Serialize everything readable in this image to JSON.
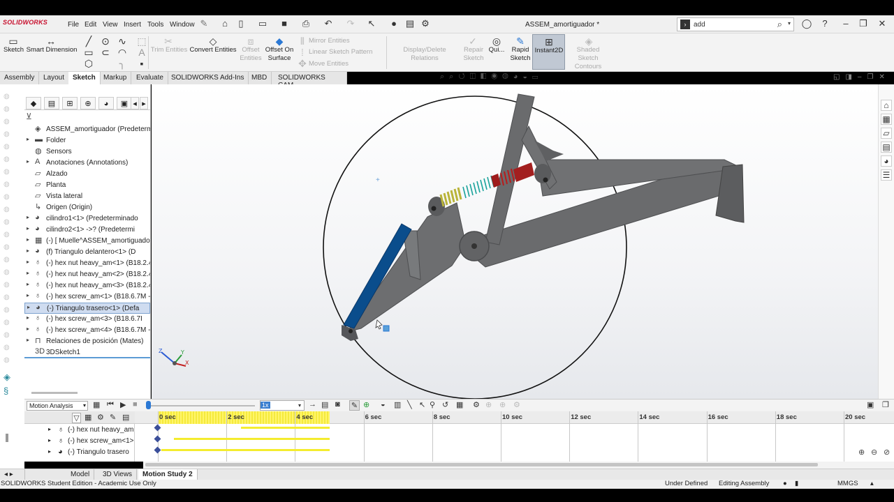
{
  "app": {
    "logo": "SOLIDWORKS",
    "doc_title": "ASSEM_amortiguador *"
  },
  "menu": [
    "File",
    "Edit",
    "View",
    "Insert",
    "Tools",
    "Window"
  ],
  "search": {
    "value": "add",
    "placeholder": ""
  },
  "ribbon": {
    "sketch": "Sketch",
    "smart_dimension": "Smart Dimension",
    "trim_entities": "Trim Entities",
    "convert_entities": "Convert Entities",
    "offset_entities": "Offset\nEntities",
    "offset_on_surface": "Offset On\nSurface",
    "mirror_entities": "Mirror Entities",
    "linear_sketch_pattern": "Linear Sketch Pattern",
    "move_entities": "Move Entities",
    "display_delete_relations": "Display/Delete Relations",
    "repair_sketch": "Repair\nSketch",
    "quick_snaps": "Qui...",
    "rapid_sketch": "Rapid\nSketch",
    "instant2d": "Instant2D",
    "shaded_sketch_contours": "Shaded Sketch\nContours"
  },
  "tabs": [
    "Assembly",
    "Layout",
    "Sketch",
    "Markup",
    "Evaluate",
    "SOLIDWORKS Add-Ins",
    "MBD",
    "SOLIDWORKS CAM"
  ],
  "active_tab": "Sketch",
  "feature_tree": [
    {
      "label": "ASSEM_amortiguador (Predeterm",
      "icon": "assembly-icon",
      "arrow": ""
    },
    {
      "label": "Folder",
      "icon": "folder-icon",
      "arrow": "▸"
    },
    {
      "label": "Sensors",
      "icon": "sensor-icon",
      "arrow": ""
    },
    {
      "label": "Anotaciones (Annotations)",
      "icon": "annotation-icon",
      "arrow": "▸"
    },
    {
      "label": "Alzado",
      "icon": "plane-icon",
      "arrow": ""
    },
    {
      "label": "Planta",
      "icon": "plane-icon",
      "arrow": ""
    },
    {
      "label": "Vista lateral",
      "icon": "plane-icon",
      "arrow": ""
    },
    {
      "label": "Origen (Origin)",
      "icon": "origin-icon",
      "arrow": ""
    },
    {
      "label": "cilindro1<1> (Predeterminado",
      "icon": "part-icon",
      "arrow": "▸"
    },
    {
      "label": "cilindro2<1> ->? (Predetermi",
      "icon": "part-icon",
      "arrow": "▸"
    },
    {
      "label": "(-) [ Muelle^ASSEM_amortiguado",
      "icon": "spring-part-icon",
      "arrow": "▸"
    },
    {
      "label": "(f) Triangulo delantero<1> (D",
      "icon": "part-icon",
      "arrow": "▸"
    },
    {
      "label": "(-) hex nut heavy_am<1> (B18.2.4",
      "icon": "toolbox-icon",
      "arrow": "▸"
    },
    {
      "label": "(-) hex nut heavy_am<2> (B18.2.4",
      "icon": "toolbox-icon",
      "arrow": "▸"
    },
    {
      "label": "(-) hex nut heavy_am<3> (B18.2.4",
      "icon": "toolbox-icon",
      "arrow": "▸"
    },
    {
      "label": "(-) hex screw_am<1> (B18.6.7M -",
      "icon": "toolbox-icon",
      "arrow": "▸"
    },
    {
      "label": "(-) Triangulo trasero<1> (Defa",
      "icon": "part-icon",
      "arrow": "▸"
    },
    {
      "label": "(-) hex screw_am<3> (B18.6.7I",
      "icon": "toolbox-icon",
      "arrow": "▸"
    },
    {
      "label": "(-) hex screw_am<4> (B18.6.7M -",
      "icon": "toolbox-icon",
      "arrow": "▸"
    },
    {
      "label": "Relaciones de posición (Mates)",
      "icon": "mates-icon",
      "arrow": "▸"
    },
    {
      "label": "3DSketch1",
      "icon": "sketch3d-icon",
      "arrow": ""
    }
  ],
  "selected_tree_item": 16,
  "motion": {
    "study_type": "Motion Analysis",
    "speed": "1x",
    "rows": [
      {
        "label": "(-) hex nut heavy_am",
        "icon": "toolbox-icon"
      },
      {
        "label": "(-) hex screw_am<1>",
        "icon": "toolbox-icon"
      },
      {
        "label": "(-) Triangulo trasero",
        "icon": "part-icon"
      }
    ],
    "time_labels": [
      "0 sec",
      "2 sec",
      "4 sec",
      "6 sec",
      "8 sec",
      "10 sec",
      "12 sec",
      "14 sec",
      "16 sec",
      "18 sec",
      "20 sec"
    ]
  },
  "bottom_tabs": [
    "Model",
    "3D Views",
    "Motion Study 2"
  ],
  "active_bottom_tab": "Motion Study 2",
  "status": {
    "left": "SOLIDWORKS Student Edition - Academic Use Only",
    "state": "Under Defined",
    "mode": "Editing Assembly",
    "units": "MMGS"
  },
  "colors": {
    "accent": "#2b78d4",
    "frame": "#5f6062",
    "link": "#0a4d8c",
    "spring_yellow": "#d7d33b",
    "spring_teal": "#1ba39c",
    "damper_red": "#b81c1c",
    "timeline_yellow": "#f4ec2e"
  }
}
